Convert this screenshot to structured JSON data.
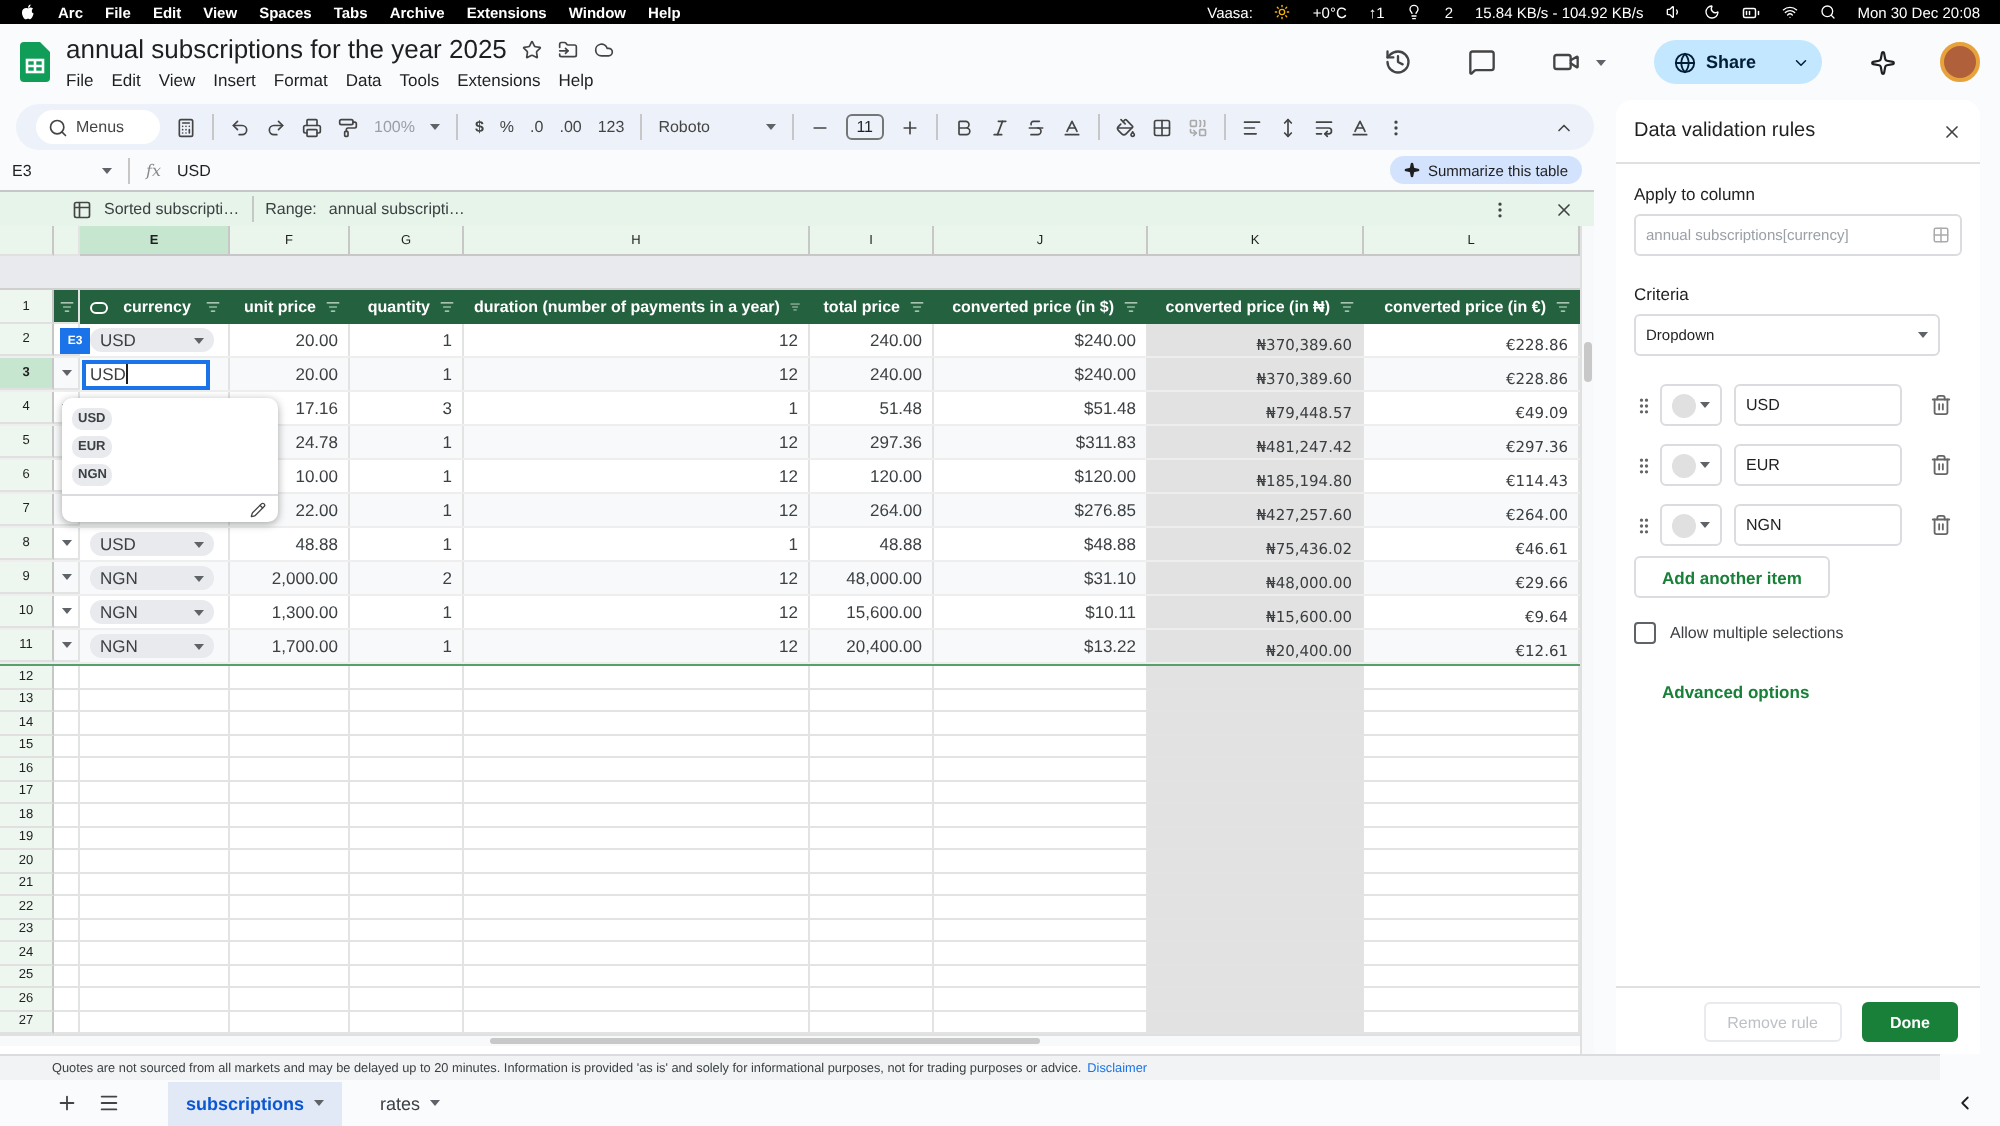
{
  "menubar": {
    "menus": [
      "Arc",
      "File",
      "Edit",
      "View",
      "Spaces",
      "Tabs",
      "Archive",
      "Extensions",
      "Window",
      "Help"
    ],
    "status": {
      "weather_city": "Vaasa:",
      "temperature": "+0°C",
      "uploads": "↑1",
      "bulb_count": "2",
      "network": "15.84 KB/s - 104.92 KB/s",
      "clock": "Mon 30 Dec 20:08"
    }
  },
  "document": {
    "title": "annual subscriptions for the year 2025",
    "menus": [
      "File",
      "Edit",
      "View",
      "Insert",
      "Format",
      "Data",
      "Tools",
      "Extensions",
      "Help"
    ],
    "share": "Share"
  },
  "toolbar": {
    "search": "Menus",
    "zoom": "100%",
    "formats": [
      "$",
      "%",
      ".0",
      ".00",
      "123"
    ],
    "font": "Roboto",
    "font_size": "11"
  },
  "formula_bar": {
    "cell": "E3",
    "fx_label": "fx",
    "value": "USD",
    "summarize": "Summarize this table"
  },
  "table_banner": {
    "name": "Sorted subscripti…",
    "range_label": "Range:",
    "range": "annual subscripti…"
  },
  "columns": [
    {
      "letter": "E",
      "selected": true,
      "shaded": false
    },
    {
      "letter": "F",
      "selected": false,
      "shaded": false
    },
    {
      "letter": "G",
      "selected": false,
      "shaded": false
    },
    {
      "letter": "H",
      "selected": false,
      "shaded": false
    },
    {
      "letter": "I",
      "selected": false,
      "shaded": false
    },
    {
      "letter": "J",
      "selected": false,
      "shaded": false
    },
    {
      "letter": "K",
      "selected": false,
      "shaded": true
    },
    {
      "letter": "L",
      "selected": false,
      "shaded": false
    }
  ],
  "header_row": {
    "number": "1",
    "headers": [
      "currency",
      "unit price",
      "quantity",
      "duration (number of payments in a year)",
      "total price",
      "converted price (in $)",
      "converted price (in ₦)",
      "converted price (in €)"
    ]
  },
  "rows": [
    {
      "number": "2",
      "selected": false,
      "currency": "USD",
      "cells": [
        "20.00",
        "1",
        "12",
        "240.00",
        "$240.00",
        "₦370,389.60",
        "€228.86"
      ]
    },
    {
      "number": "3",
      "selected": true,
      "cells": [
        "20.00",
        "1",
        "12",
        "240.00",
        "$240.00",
        "₦370,389.60",
        "€228.86"
      ]
    },
    {
      "number": "4",
      "selected": false,
      "cells": [
        "17.16",
        "3",
        "1",
        "51.48",
        "$51.48",
        "₦79,448.57",
        "€49.09"
      ]
    },
    {
      "number": "5",
      "selected": false,
      "cells": [
        "24.78",
        "1",
        "12",
        "297.36",
        "$311.83",
        "₦481,247.42",
        "€297.36"
      ]
    },
    {
      "number": "6",
      "selected": false,
      "cells": [
        "10.00",
        "1",
        "12",
        "120.00",
        "$120.00",
        "₦185,194.80",
        "€114.43"
      ]
    },
    {
      "number": "7",
      "selected": false,
      "cells": [
        "22.00",
        "1",
        "12",
        "264.00",
        "$276.85",
        "₦427,257.60",
        "€264.00"
      ]
    },
    {
      "number": "8",
      "selected": false,
      "currency": "USD",
      "cells": [
        "48.88",
        "1",
        "1",
        "48.88",
        "$48.88",
        "₦75,436.02",
        "€46.61"
      ]
    },
    {
      "number": "9",
      "selected": false,
      "currency": "NGN",
      "cells": [
        "2,000.00",
        "2",
        "12",
        "48,000.00",
        "$31.10",
        "₦48,000.00",
        "€29.66"
      ]
    },
    {
      "number": "10",
      "selected": false,
      "currency": "NGN",
      "cells": [
        "1,300.00",
        "1",
        "12",
        "15,600.00",
        "$10.11",
        "₦15,600.00",
        "€9.64"
      ]
    },
    {
      "number": "11",
      "selected": false,
      "currency": "NGN",
      "cells": [
        "1,700.00",
        "1",
        "12",
        "20,400.00",
        "$13.22",
        "₦20,400.00",
        "€12.61"
      ]
    }
  ],
  "empty_rows": [
    "12",
    "13",
    "14",
    "15",
    "16",
    "17",
    "18",
    "19",
    "20",
    "21",
    "22",
    "23",
    "24",
    "25",
    "26",
    "27"
  ],
  "dropdown": {
    "cell_tag": "E3",
    "value": "USD",
    "options": [
      "USD",
      "EUR",
      "NGN"
    ]
  },
  "panel": {
    "title": "Data validation rules",
    "apply_label": "Apply to column",
    "apply_value": "annual subscriptions[currency]",
    "criteria_label": "Criteria",
    "criteria": "Dropdown",
    "items": [
      "USD",
      "EUR",
      "NGN"
    ],
    "add_item": "Add another item",
    "allow_multiple": {
      "label": "Allow multiple selections",
      "checked": false
    },
    "advanced": "Advanced options",
    "remove": {
      "label": "Remove rule",
      "disabled": true
    },
    "done": "Done"
  },
  "disclaimer": {
    "text": "Quotes are not sourced from all markets and may be delayed up to 20 minutes. Information is provided 'as is' and solely for informational purposes, not for trading purposes or advice.",
    "link": "Disclaimer"
  },
  "sheets": [
    {
      "label": "subscriptions",
      "selected": true
    },
    {
      "label": "rates",
      "selected": false
    }
  ]
}
